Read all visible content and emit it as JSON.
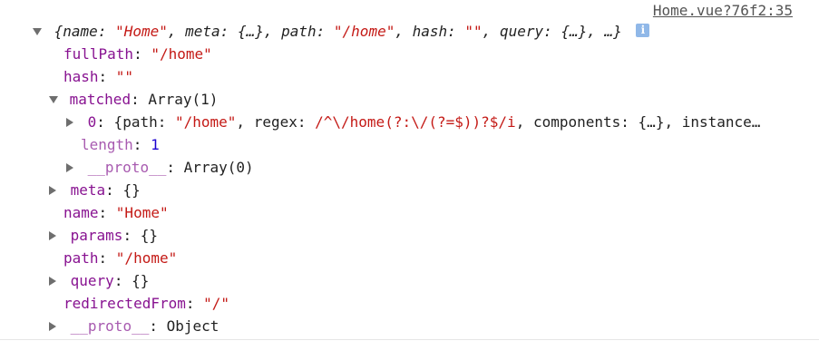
{
  "console": {
    "source_link": "Home.vue?76f2:35",
    "info_icon_label": "i",
    "summary": {
      "open": "{",
      "name_key": "name",
      "name_val": "\"Home\"",
      "meta_key": "meta",
      "meta_val": "{…}",
      "path_key": "path",
      "path_val": "\"/home\"",
      "hash_key": "hash",
      "hash_val": "\"\"",
      "query_key": "query",
      "query_val": "{…}",
      "tail": "…}"
    },
    "props": {
      "fullPath": {
        "key": "fullPath",
        "value": "\"/home\""
      },
      "hash": {
        "key": "hash",
        "value": "\"\""
      },
      "matched": {
        "key": "matched",
        "value": "Array(1)"
      },
      "matched_0": {
        "key": "0",
        "open": "{",
        "path_key": "path",
        "path_val": "\"/home\"",
        "regex_key": "regex",
        "regex_val": "/^\\/home(?:\\/(?=$))?$/i",
        "components_key": "components",
        "components_val": "{…}",
        "instance_key": "instance…"
      },
      "matched_length": {
        "key": "length",
        "value": "1"
      },
      "matched_proto": {
        "key": "__proto__",
        "value": "Array(0)"
      },
      "meta": {
        "key": "meta",
        "value": "{}"
      },
      "name": {
        "key": "name",
        "value": "\"Home\""
      },
      "params": {
        "key": "params",
        "value": "{}"
      },
      "path": {
        "key": "path",
        "value": "\"/home\""
      },
      "query": {
        "key": "query",
        "value": "{}"
      },
      "redirectedFrom": {
        "key": "redirectedFrom",
        "value": "\"/\""
      },
      "proto": {
        "key": "__proto__",
        "value": "Object"
      }
    }
  },
  "colors": {
    "key": "#881391",
    "string": "#c41a16",
    "number": "#1c00cf",
    "text": "#222222",
    "info_icon": "#90b8e8"
  }
}
